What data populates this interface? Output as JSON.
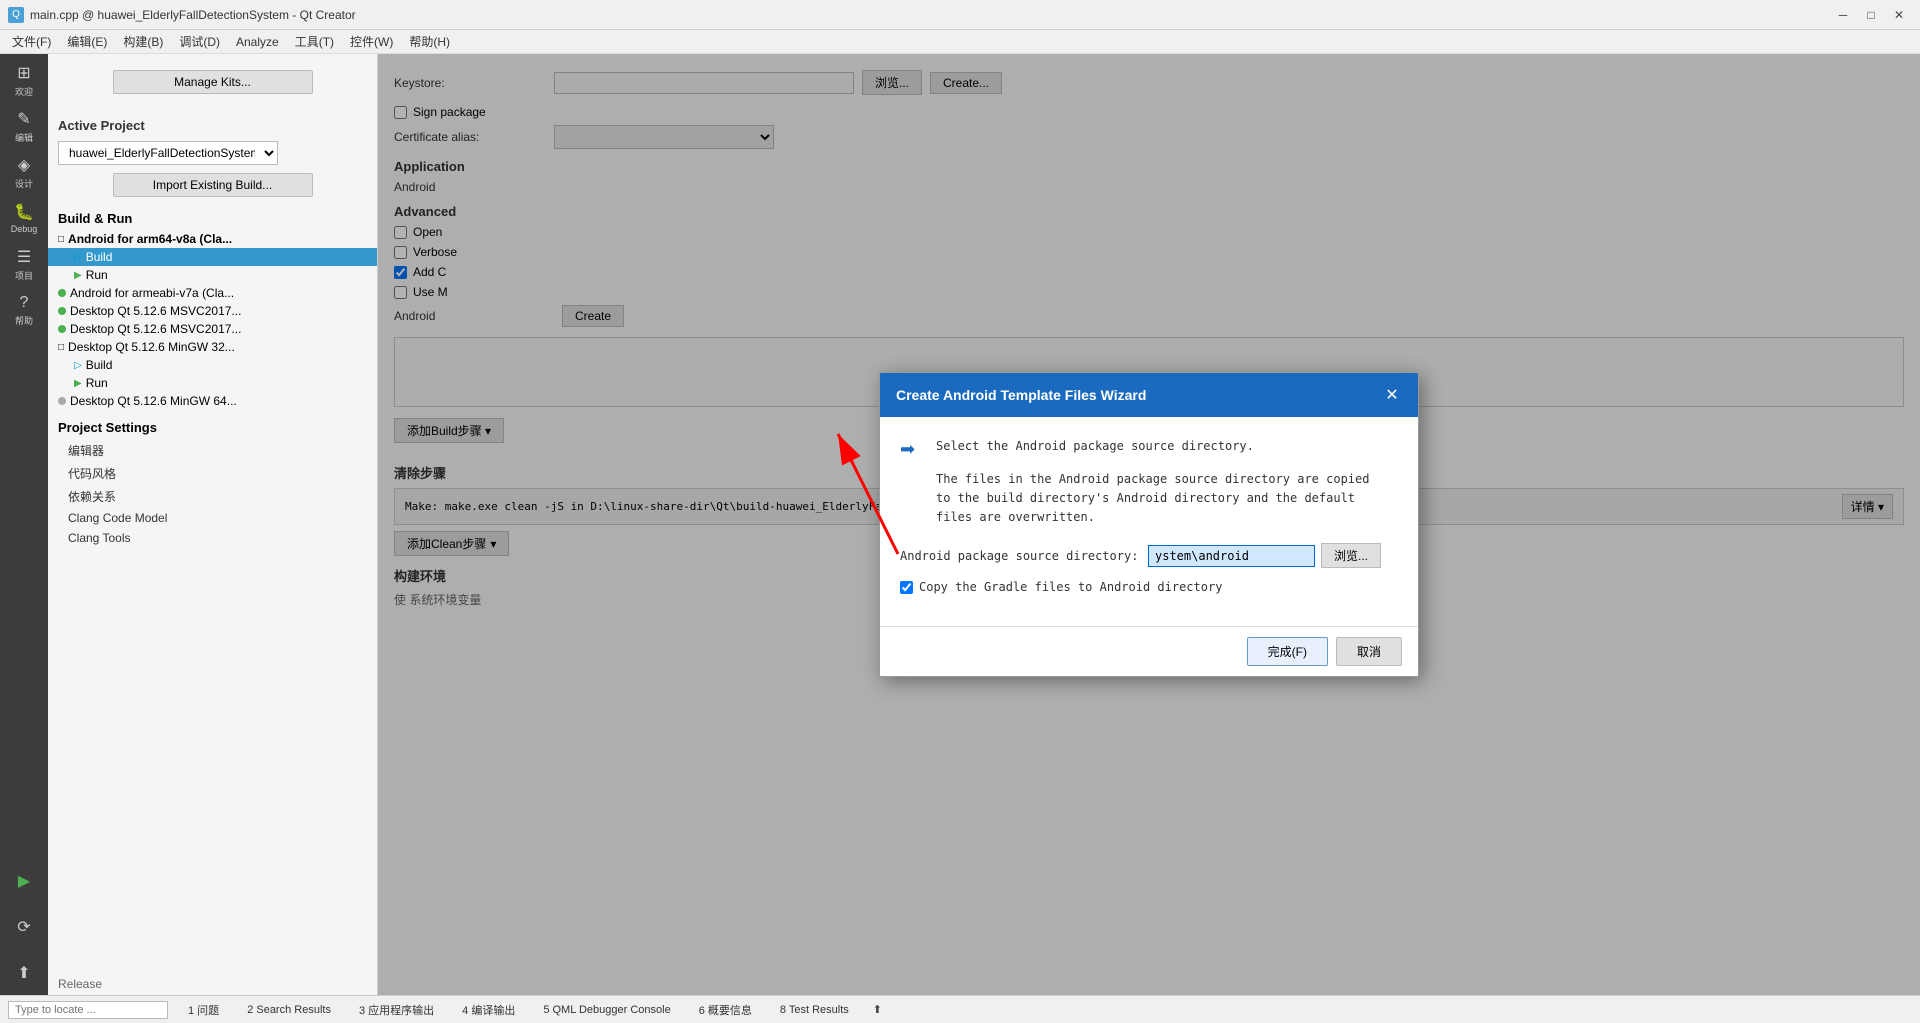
{
  "window": {
    "title": "main.cpp @ huawei_ElderlyFallDetectionSystem - Qt Creator",
    "minimize": "─",
    "maximize": "□",
    "close": "✕"
  },
  "menu": {
    "items": [
      "文件(F)",
      "编辑(E)",
      "构建(B)",
      "调试(D)",
      "Analyze",
      "工具(T)",
      "控件(W)",
      "帮助(H)"
    ]
  },
  "sidebar_icons": [
    {
      "name": "welcome",
      "symbol": "⊞",
      "label": "欢迎"
    },
    {
      "name": "edit",
      "symbol": "✏",
      "label": "编辑"
    },
    {
      "name": "design",
      "symbol": "◈",
      "label": "设计"
    },
    {
      "name": "debug",
      "symbol": "🐛",
      "label": "Debug"
    },
    {
      "name": "project",
      "symbol": "☰",
      "label": "项目"
    },
    {
      "name": "help",
      "symbol": "?",
      "label": "帮助"
    }
  ],
  "left_panel": {
    "manage_kits_btn": "Manage Kits...",
    "active_project_label": "Active Project",
    "project_name": "huawei_ElderlyFallDetectionSystem",
    "import_btn": "Import Existing Build...",
    "build_run_title": "Build & Run",
    "tree": [
      {
        "level": 1,
        "icon": "folder",
        "label": "Android for arm64-v8a (Cla...",
        "bold": true
      },
      {
        "level": 2,
        "icon": "arrow-build",
        "label": "Build",
        "selected": true
      },
      {
        "level": 2,
        "icon": "arrow-run",
        "label": "Run"
      },
      {
        "level": 1,
        "icon": "dot-green",
        "label": "Android for armeabi-v7a (Cla..."
      },
      {
        "level": 1,
        "icon": "dot-green",
        "label": "Desktop Qt 5.12.6 MSVC2017..."
      },
      {
        "level": 1,
        "icon": "dot-green",
        "label": "Desktop Qt 5.12.6 MSVC2017..."
      },
      {
        "level": 1,
        "icon": "folder",
        "label": "Desktop Qt 5.12.6 MinGW 32...",
        "bold": false
      },
      {
        "level": 2,
        "icon": "arrow-build",
        "label": "Build"
      },
      {
        "level": 2,
        "icon": "arrow-run",
        "label": "Run"
      },
      {
        "level": 1,
        "icon": "dot-gray",
        "label": "Desktop Qt 5.12.6 MinGW 64..."
      }
    ],
    "project_settings_title": "Project Settings",
    "settings_items": [
      "编辑器",
      "代码风格",
      "依赖关系",
      "Clang Code Model",
      "Clang Tools"
    ]
  },
  "right_panel": {
    "keystore_label": "Keystore:",
    "browse_btn": "浏览...",
    "create_btn": "Create...",
    "sign_package_label": "Sign package",
    "cert_alias_label": "Certificate alias:",
    "application_label": "Application",
    "android_label": "Android",
    "advanced_label": "Advanced",
    "open_label": "Open",
    "verbose_label": "Verbose",
    "add_label": "Add C",
    "use_label": "Use M",
    "android_build_label": "Android",
    "create_btn2": "Create",
    "add_build_label": "添加Build步骤",
    "clean_steps_title": "清除步骤",
    "clean_step_make": "Make: make.exe clean -jS in D:\\linux-share-dir\\Qt\\build-huawei_ElderlyFa",
    "details_btn": "详情 ▾",
    "add_clean_btn": "添加Clean步骤",
    "build_env_title": "构建环境",
    "use_sys_env_label": "使 系统环境变量"
  },
  "modal": {
    "title": "Create Android Template Files Wizard",
    "close_btn": "✕",
    "description1": "Select the Android package source directory.",
    "description2": "The files in the Android package source directory are copied",
    "description3": "to the build directory's Android directory and the default",
    "description4": "files are overwritten.",
    "source_dir_label": "Android package source directory:",
    "source_dir_value": "ystem\\android",
    "browse_btn": "浏览...",
    "copy_gradle_label": "Copy the Gradle files to Android directory",
    "copy_gradle_checked": true,
    "finish_btn": "完成(F)",
    "cancel_btn": "取消"
  },
  "status_bar": {
    "search_placeholder": "Type to locate ...",
    "tabs": [
      "1 问题",
      "2 Search Results",
      "3 应用程序输出",
      "4 编译输出",
      "5 QML Debugger Console",
      "6 概要信息",
      "8 Test Results"
    ]
  },
  "bottom_left": {
    "release_label": "Release"
  }
}
